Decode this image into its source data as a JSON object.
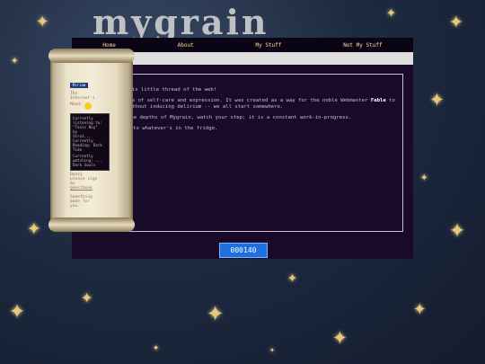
{
  "site": {
    "logo_text": "mygrain"
  },
  "nav": {
    "items": [
      "Home",
      "About",
      "My Stuff",
      "Not My Stuff"
    ]
  },
  "content": {
    "line1": "rain is little thread of the web!",
    "line2_a": "ebsite of self-care and expression. It was created as a way for the noble Webmaster ",
    "line2_name": "Fable",
    "line2_b": " to",
    "line3": "et without inducing delirium -- we all start somewhere.",
    "line4": "the depths of Mygrain, watch your step; it is a constant work-in-progress.",
    "line5": "lf to whatever's in the fridge."
  },
  "sidebar": {
    "badge": "Miriam",
    "line1": "The",
    "line2": "Internet's",
    "line3": "Mood:",
    "box_lines": [
      "Currently",
      "listening to:",
      "\"Toxic Boy\"",
      "by",
      "Strut...",
      "Currently",
      "Reading: Dark",
      "Tide",
      "Currently",
      "watching: ...",
      "Dark Souls"
    ],
    "line4": "Doozy",
    "line5": "please sign",
    "line6": "my",
    "line7": "guestbook",
    "line8": "Something",
    "line9": "made for",
    "line10": "you."
  },
  "counter": {
    "value": "000140"
  },
  "colors": {
    "nav_text": "#f0e0a0",
    "main_bg": "#1a0a2a",
    "counter_bg": "#1e6fe0"
  }
}
